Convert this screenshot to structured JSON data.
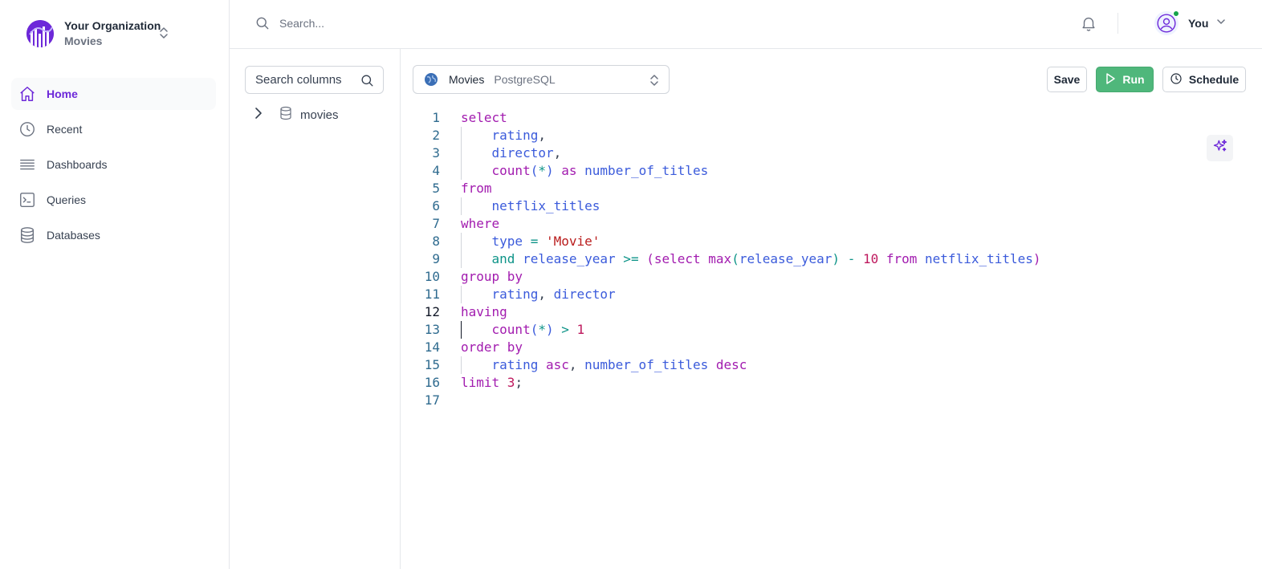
{
  "org": {
    "name": "Your Organization",
    "subtitle": "Movies"
  },
  "sidebar": {
    "items": [
      {
        "label": "Home",
        "icon": "home-icon",
        "active": true
      },
      {
        "label": "Recent",
        "icon": "clock-icon",
        "active": false
      },
      {
        "label": "Dashboards",
        "icon": "menu-lines-icon",
        "active": false
      },
      {
        "label": "Queries",
        "icon": "terminal-icon",
        "active": false
      },
      {
        "label": "Databases",
        "icon": "database-icon",
        "active": false
      }
    ]
  },
  "topbar": {
    "search_placeholder": "Search...",
    "user_name": "You"
  },
  "schema": {
    "search_placeholder": "Search columns",
    "tree": [
      {
        "label": "movies"
      }
    ]
  },
  "toolbar": {
    "db_name": "Movies",
    "db_engine": "PostgreSQL",
    "save_label": "Save",
    "run_label": "Run",
    "schedule_label": "Schedule"
  },
  "colors": {
    "accent": "#6d28d9",
    "run_green": "#4fb77b",
    "keyword": "#a21caf",
    "identifier": "#3b5bdb",
    "string": "#b91c1c",
    "number": "#be185d"
  },
  "editor": {
    "current_line": 12,
    "lines": [
      {
        "n": "1",
        "indent": false,
        "tokens": [
          {
            "t": "select",
            "c": "kw"
          }
        ]
      },
      {
        "n": "2",
        "indent": true,
        "tokens": [
          {
            "t": "rating",
            "c": "id"
          },
          {
            "t": ",",
            "c": "pn"
          }
        ]
      },
      {
        "n": "3",
        "indent": true,
        "tokens": [
          {
            "t": "director",
            "c": "id"
          },
          {
            "t": ",",
            "c": "pn"
          }
        ]
      },
      {
        "n": "4",
        "indent": true,
        "tokens": [
          {
            "t": "count",
            "c": "fn"
          },
          {
            "t": "(",
            "c": "id"
          },
          {
            "t": "*",
            "c": "op"
          },
          {
            "t": ")",
            "c": "id"
          },
          {
            "t": " as ",
            "c": "kw"
          },
          {
            "t": "number_of_titles",
            "c": "id"
          }
        ]
      },
      {
        "n": "5",
        "indent": false,
        "tokens": [
          {
            "t": "from",
            "c": "kw"
          }
        ]
      },
      {
        "n": "6",
        "indent": true,
        "tokens": [
          {
            "t": "netflix_titles",
            "c": "id"
          }
        ]
      },
      {
        "n": "7",
        "indent": false,
        "tokens": [
          {
            "t": "where",
            "c": "kw"
          }
        ]
      },
      {
        "n": "8",
        "indent": true,
        "tokens": [
          {
            "t": "type",
            "c": "id"
          },
          {
            "t": " = ",
            "c": "op"
          },
          {
            "t": "'Movie'",
            "c": "str"
          }
        ]
      },
      {
        "n": "9",
        "indent": true,
        "tokens": [
          {
            "t": "and",
            "c": "op"
          },
          {
            "t": " ",
            "c": "pn"
          },
          {
            "t": "release_year",
            "c": "id"
          },
          {
            "t": " >= ",
            "c": "op"
          },
          {
            "t": "(",
            "c": "kw"
          },
          {
            "t": "select",
            "c": "kw"
          },
          {
            "t": " ",
            "c": "pn"
          },
          {
            "t": "max",
            "c": "fn"
          },
          {
            "t": "(",
            "c": "op"
          },
          {
            "t": "release_year",
            "c": "id"
          },
          {
            "t": ")",
            "c": "op"
          },
          {
            "t": " - ",
            "c": "op"
          },
          {
            "t": "10",
            "c": "num"
          },
          {
            "t": " from ",
            "c": "kw"
          },
          {
            "t": "netflix_titles",
            "c": "id"
          },
          {
            "t": ")",
            "c": "kw"
          }
        ]
      },
      {
        "n": "10",
        "indent": false,
        "tokens": [
          {
            "t": "group by",
            "c": "kw"
          }
        ]
      },
      {
        "n": "11",
        "indent": true,
        "tokens": [
          {
            "t": "rating",
            "c": "id"
          },
          {
            "t": ", ",
            "c": "pn"
          },
          {
            "t": "director",
            "c": "id"
          }
        ]
      },
      {
        "n": "12",
        "indent": false,
        "tokens": [
          {
            "t": "having",
            "c": "kw"
          }
        ]
      },
      {
        "n": "13",
        "indent": true,
        "tokens": [
          {
            "t": "count",
            "c": "fn"
          },
          {
            "t": "(",
            "c": "id"
          },
          {
            "t": "*",
            "c": "op"
          },
          {
            "t": ")",
            "c": "id"
          },
          {
            "t": " > ",
            "c": "op"
          },
          {
            "t": "1",
            "c": "num"
          }
        ]
      },
      {
        "n": "14",
        "indent": false,
        "tokens": [
          {
            "t": "order by",
            "c": "kw"
          }
        ]
      },
      {
        "n": "15",
        "indent": true,
        "tokens": [
          {
            "t": "rating",
            "c": "id"
          },
          {
            "t": " asc",
            "c": "kw"
          },
          {
            "t": ", ",
            "c": "pn"
          },
          {
            "t": "number_of_titles",
            "c": "id"
          },
          {
            "t": " desc",
            "c": "kw"
          }
        ]
      },
      {
        "n": "16",
        "indent": false,
        "tokens": [
          {
            "t": "limit ",
            "c": "kw"
          },
          {
            "t": "3",
            "c": "num"
          },
          {
            "t": ";",
            "c": "pn"
          }
        ]
      },
      {
        "n": "17",
        "indent": false,
        "tokens": []
      }
    ]
  }
}
